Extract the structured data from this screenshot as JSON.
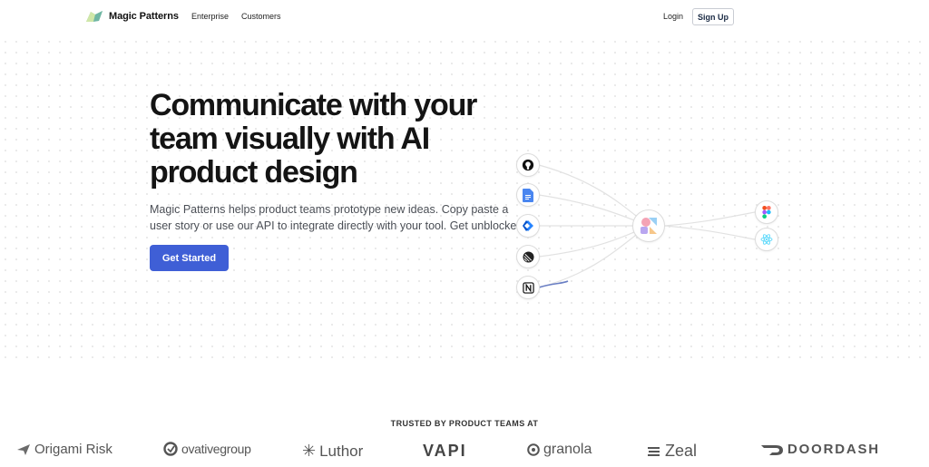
{
  "nav": {
    "brand": "Magic Patterns",
    "links": [
      "Enterprise",
      "Customers"
    ],
    "login": "Login",
    "signup": "Sign Up"
  },
  "hero": {
    "title": "Communicate with your team visually with AI product design",
    "subtitle": "Magic Patterns helps product teams prototype new ideas. Copy paste a user story or use our API to integrate directly with your tool. Get unblocked.",
    "cta": "Get Started"
  },
  "integrations": {
    "inputs": [
      "github-icon",
      "google-docs-icon",
      "jira-icon",
      "linear-icon",
      "notion-icon"
    ],
    "hub": "magic-patterns-icon",
    "outputs": [
      "figma-icon",
      "react-icon"
    ]
  },
  "trusted": {
    "label": "TRUSTED BY PRODUCT TEAMS AT",
    "logos": [
      "Origami Risk",
      "ovativegroup",
      "Luthor",
      "VAPI",
      "granola",
      "Zeal",
      "DOORDASH"
    ]
  },
  "colors": {
    "accent": "#3f5fd6",
    "heading": "#141414",
    "body": "#4b4f56"
  }
}
